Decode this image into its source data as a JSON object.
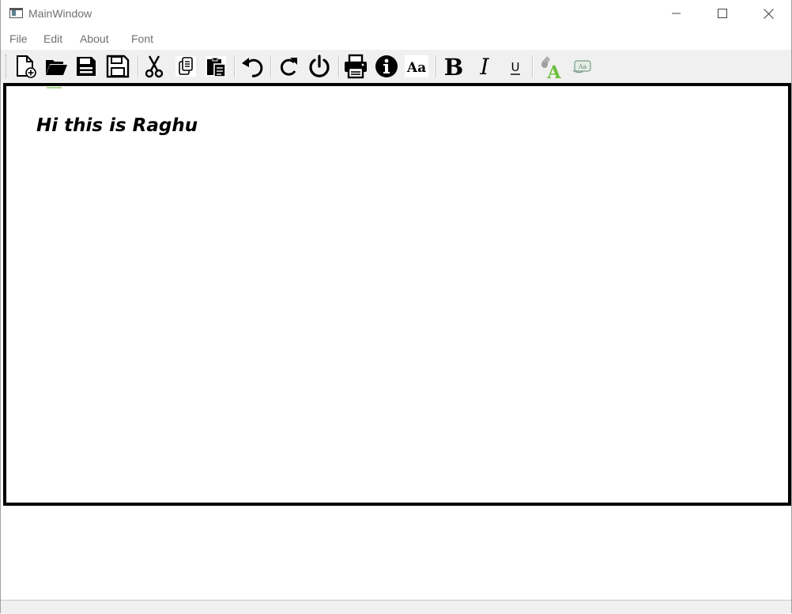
{
  "window": {
    "title": "MainWindow"
  },
  "menu": {
    "items": [
      {
        "label": "File"
      },
      {
        "label": "Edit"
      },
      {
        "label": "About"
      },
      {
        "label": "Font"
      }
    ]
  },
  "toolbar": {
    "buttons": [
      {
        "icon": "new-file-icon"
      },
      {
        "icon": "open-folder-icon"
      },
      {
        "icon": "save-icon"
      },
      {
        "icon": "save-as-icon"
      },
      {
        "icon": "cut-icon"
      },
      {
        "icon": "copy-icon"
      },
      {
        "icon": "paste-icon"
      },
      {
        "icon": "undo-icon"
      },
      {
        "icon": "redo-icon"
      },
      {
        "icon": "power-icon"
      },
      {
        "icon": "print-icon"
      },
      {
        "icon": "info-icon"
      },
      {
        "icon": "font-icon",
        "text": "Aa"
      },
      {
        "icon": "bold-icon",
        "text": "B"
      },
      {
        "icon": "italic-icon",
        "text": "I"
      },
      {
        "icon": "underline-icon",
        "text": "U"
      },
      {
        "icon": "text-color-icon",
        "text": "A"
      },
      {
        "icon": "background-color-icon",
        "text": "Aa"
      }
    ]
  },
  "editor": {
    "content": "Hi this is Raghu"
  },
  "colors": {
    "toolbar_bg": "#f0f0f0",
    "menu_text": "#707070",
    "editor_border": "#000000",
    "accent_green": "#6cbf3c"
  }
}
